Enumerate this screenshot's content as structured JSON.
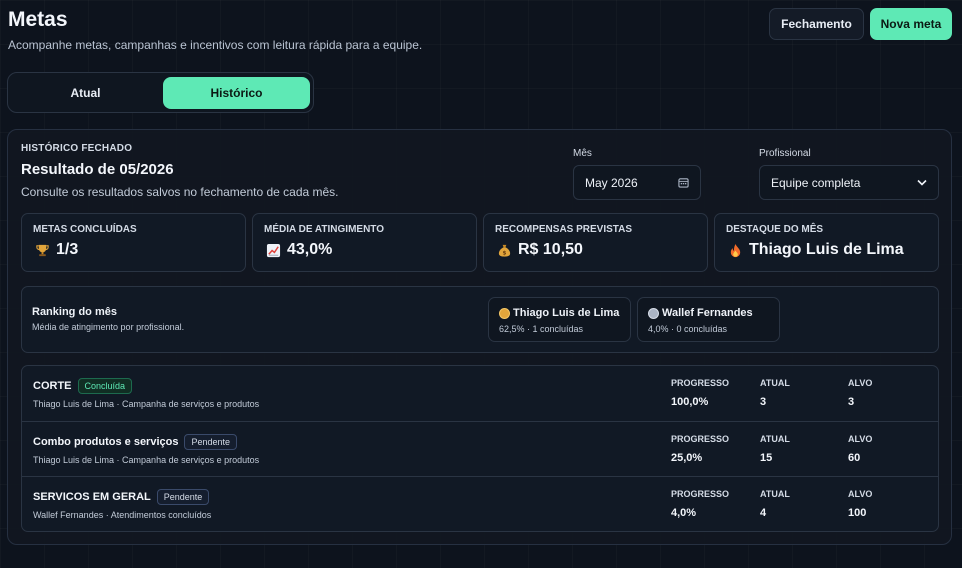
{
  "header": {
    "title": "Metas",
    "subtitle": "Acompanhe metas, campanhas e incentivos com leitura rápida para a equipe.",
    "close_label": "Fechamento",
    "new_label": "Nova meta"
  },
  "tabs": [
    {
      "label": "Atual",
      "active": false
    },
    {
      "label": "Histórico",
      "active": true
    }
  ],
  "history": {
    "kicker": "HISTÓRICO FECHADO",
    "result_title": "Resultado de 05/2026",
    "description": "Consulte os resultados salvos no fechamento de cada mês.",
    "month_label": "Mês",
    "month_value": "May 2026",
    "professional_label": "Profissional",
    "professional_value": "Equipe completa"
  },
  "stats": [
    {
      "label": "METAS CONCLUÍDAS",
      "icon": "trophy-icon",
      "value": "1/3"
    },
    {
      "label": "MÉDIA DE ATINGIMENTO",
      "icon": "chart-increasing-icon",
      "value": "43,0%"
    },
    {
      "label": "RECOMPENSAS PREVISTAS",
      "icon": "money-bag-icon",
      "value": "R$ 10,50"
    },
    {
      "label": "DESTAQUE DO MÊS",
      "icon": "fire-icon",
      "value": "Thiago Luis de Lima"
    }
  ],
  "ranking": {
    "title": "Ranking do mês",
    "subtitle": "Média de atingimento por profissional.",
    "entries": [
      {
        "name": "Thiago Luis de Lima",
        "stat": "62,5% · 1 concluídas",
        "medal": "gold-medal-icon"
      },
      {
        "name": "Wallef Fernandes",
        "stat": "4,0% · 0 concluídas",
        "medal": "silver-medal-icon"
      }
    ]
  },
  "goal_columns": {
    "progress": "PROGRESSO",
    "current": "ATUAL",
    "target": "ALVO"
  },
  "goals": [
    {
      "name": "CORTE",
      "status": "Concluída",
      "meta": "Thiago Luis de Lima · Campanha de serviços e produtos",
      "progress": "100,0%",
      "current": "3",
      "target": "3"
    },
    {
      "name": "Combo produtos e serviços",
      "status": "Pendente",
      "meta": "Thiago Luis de Lima · Campanha de serviços e produtos",
      "progress": "25,0%",
      "current": "15",
      "target": "60"
    },
    {
      "name": "SERVICOS EM GERAL",
      "status": "Pendente",
      "meta": "Wallef Fernandes · Atendimentos concluídos",
      "progress": "4,0%",
      "current": "4",
      "target": "100"
    }
  ],
  "colors": {
    "accent": "#5ee9b5",
    "background": "#0d131d",
    "panel": "#111925",
    "border": "#2a3443"
  }
}
